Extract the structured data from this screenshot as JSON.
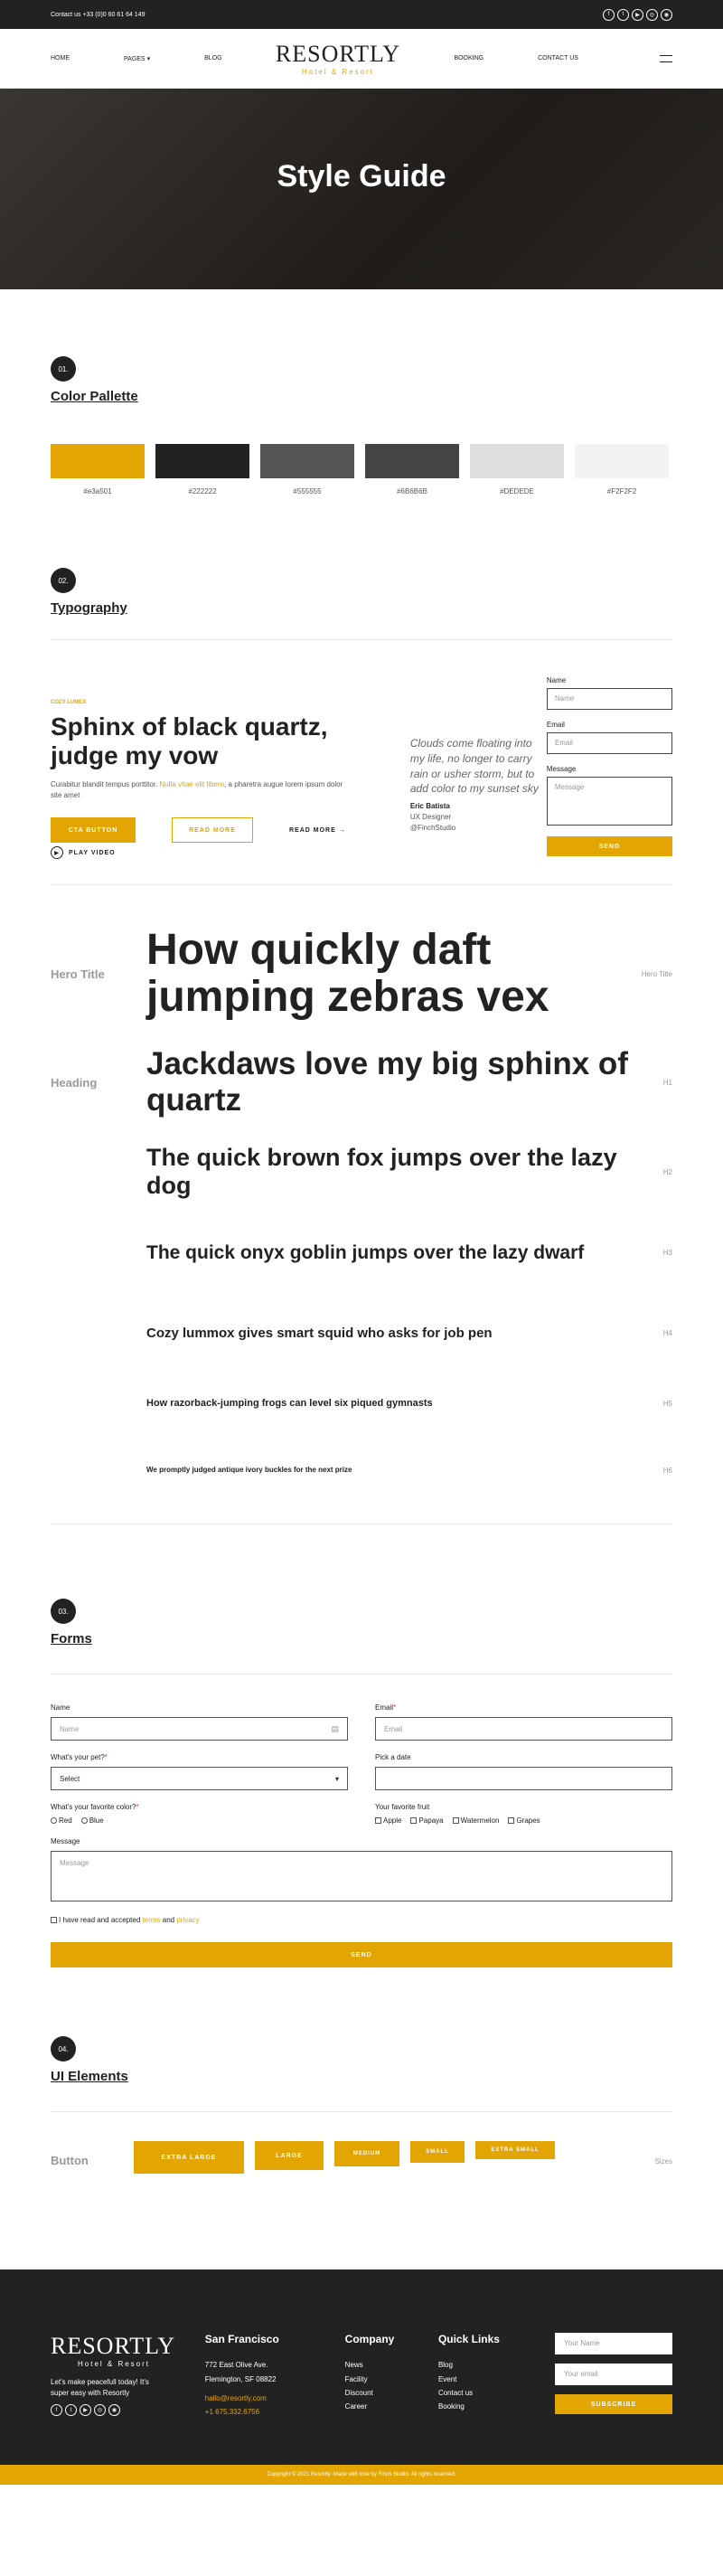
{
  "topbar": {
    "contact": "Contact us +33 (0)0 60 61 64 149",
    "social": [
      "f",
      "t",
      "▶",
      "◎",
      "◉"
    ]
  },
  "nav": {
    "left": [
      "HOME",
      "PAGES",
      "BLOG"
    ],
    "right": [
      "BOOKING",
      "CONTACT US"
    ],
    "logo_title": "RESORTLY",
    "logo_sub": "Hotel & Resort"
  },
  "hero": {
    "title": "Style Guide"
  },
  "palette": {
    "num": "01.",
    "title": "Color Pallette",
    "colors": [
      {
        "hex": "#e3a501",
        "label": "#e3a501"
      },
      {
        "hex": "#222222",
        "label": "#222222"
      },
      {
        "hex": "#555555",
        "label": "#555555"
      },
      {
        "hex": "#444444",
        "label": "#6B6B6B"
      },
      {
        "hex": "#dedede",
        "label": "#DEDEDE"
      },
      {
        "hex": "#f2f2f2",
        "label": "#F2F2F2"
      }
    ]
  },
  "typography": {
    "num": "02.",
    "title": "Typography"
  },
  "demo": {
    "kicker": "COZY LUMEX",
    "title": "Sphinx of black quartz, judge my vow",
    "para_a": "Curabitur blandit tempus porttitor. ",
    "para_link": "Nulla vitae elit libero",
    "para_b": ", a pharetra augue lorem ipsum dolor site amet",
    "btn_cta": "CTA BUTTON",
    "btn_more": "READ MORE",
    "btn_link": "READ MORE",
    "play": "PLAY VIDEO",
    "quote": "Clouds come floating into my life, no longer to carry rain or usher storm, but to add color to my sunset sky",
    "author": "Eric Batista",
    "role": "UX Designer",
    "handle": "@FinchStudio",
    "form": {
      "name_label": "Name",
      "name_ph": "Name",
      "email_label": "Email",
      "email_ph": "Email",
      "msg_label": "Message",
      "msg_ph": "Message",
      "send": "SEND"
    }
  },
  "type_rows": [
    {
      "label": "Hero Title",
      "text": "How quickly daft jumping zebras vex",
      "tag": "Hero Title"
    },
    {
      "label": "Heading",
      "text": "Jackdaws love my big sphinx of quartz",
      "tag": "H1"
    },
    {
      "label": "",
      "text": "The quick brown fox jumps over the lazy dog",
      "tag": "H2"
    },
    {
      "label": "",
      "text": "The quick onyx goblin jumps over the lazy dwarf",
      "tag": "H3"
    },
    {
      "label": "",
      "text": "Cozy lummox gives smart squid who asks for job pen",
      "tag": "H4"
    },
    {
      "label": "",
      "text": "How razorback-jumping frogs can level six piqued gymnasts",
      "tag": "H5"
    },
    {
      "label": "",
      "text": "We promptly judged antique ivory buckles for the next prize",
      "tag": "H6"
    }
  ],
  "forms": {
    "num": "03.",
    "title": "Forms",
    "name_label": "Name",
    "name_ph": "Name",
    "email_label": "Email",
    "email_ph": "Email",
    "pet_label": "What's your pet?",
    "pet_value": "Select",
    "date_label": "Pick a date",
    "color_label": "What's your favorite color?",
    "colors": [
      "Red",
      "Blue"
    ],
    "fruit_label": "Your favorite fruit",
    "fruits": [
      "Apple",
      "Papaya",
      "Watermelon",
      "Grapes"
    ],
    "msg_label": "Message",
    "msg_ph": "Message",
    "accept_a": "I have read and accepted ",
    "terms": "terms",
    "and": " and ",
    "privacy": "privacy",
    "send": "SEND"
  },
  "ui": {
    "num": "04.",
    "title": "UI Elements",
    "row_label": "Button",
    "sizes_label": "Sizes",
    "buttons": [
      "EXTRA LARGE",
      "LARGE",
      "MEDIUM",
      "SMALL",
      "EXTRA SMALL"
    ]
  },
  "footer": {
    "logo_title": "RESORTLY",
    "logo_sub": "Hotel & Resort",
    "tagline": "Let's make peacefull today! It's super easy with Resortly",
    "city": "San Francisco",
    "addr1": "772 East Olive Ave.",
    "addr2": "Flemington, SF 08822",
    "email": "hallo@resortly.com",
    "phone": "+1 675.332.6756",
    "company_title": "Company",
    "company": [
      "News",
      "Facility",
      "Discount",
      "Career"
    ],
    "quick_title": "Quick Links",
    "quick": [
      "Blog",
      "Event",
      "Contact us",
      "Booking"
    ],
    "name_ph": "Your Name",
    "email_ph": "Your email",
    "subscribe": "SUBSCRIBE",
    "copyright": "Copyright © 2021 Resortly. Made with love by Finch Studio. All rights reserved."
  }
}
